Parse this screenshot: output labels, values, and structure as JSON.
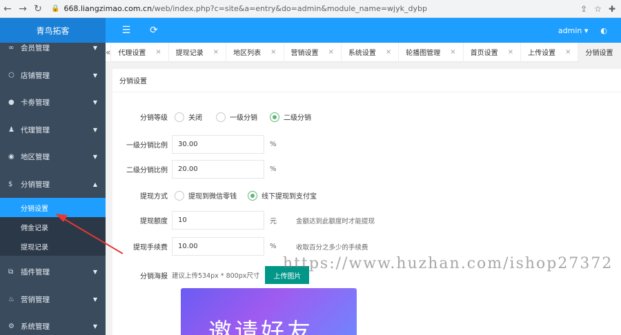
{
  "browser": {
    "url_host": "668.liangzimao.com.cn",
    "url_path": "/web/index.php?c=site&a=entry&do=admin&module_name=wjyk_dybp"
  },
  "header": {
    "brand": "青鸟拓客",
    "user": "admin"
  },
  "sidebar": {
    "items": [
      {
        "label": "会员管理",
        "icon": "link-icon"
      },
      {
        "label": "店铺管理",
        "icon": "cube-icon"
      },
      {
        "label": "卡劵管理",
        "icon": "circle-icon"
      },
      {
        "label": "代理管理",
        "icon": "user-icon"
      },
      {
        "label": "地区管理",
        "icon": "compass-icon"
      },
      {
        "label": "分销管理",
        "icon": "money-icon"
      }
    ],
    "sub_items": [
      {
        "label": "分销设置",
        "active": true
      },
      {
        "label": "佣金记录",
        "active": false
      },
      {
        "label": "提现记录",
        "active": false
      }
    ],
    "more_items": [
      {
        "label": "插件管理",
        "icon": "plugin-icon"
      },
      {
        "label": "营销管理",
        "icon": "fire-icon"
      },
      {
        "label": "系统管理",
        "icon": "gear-icon"
      }
    ]
  },
  "tabs": [
    {
      "label": "代理设置"
    },
    {
      "label": "提现记录"
    },
    {
      "label": "地区列表"
    },
    {
      "label": "营销设置"
    },
    {
      "label": "系统设置"
    },
    {
      "label": "轮播图管理"
    },
    {
      "label": "首页设置"
    },
    {
      "label": "上传设置"
    },
    {
      "label": "分销设置",
      "active": true
    }
  ],
  "panel": {
    "title": "分销设置"
  },
  "form": {
    "level_label": "分销等级",
    "level_options": [
      "关闭",
      "一级分销",
      "二级分销"
    ],
    "level_selected": "二级分销",
    "first_ratio_label": "一级分销比例",
    "first_ratio_value": "30.00",
    "second_ratio_label": "二级分销比例",
    "second_ratio_value": "20.00",
    "percent_unit": "%",
    "withdraw_method_label": "提现方式",
    "withdraw_options": [
      "提现到微信零钱",
      "线下提现到支付宝"
    ],
    "withdraw_selected": "线下提现到支付宝",
    "withdraw_amount_label": "提现额度",
    "withdraw_amount_value": "10",
    "yuan_unit": "元",
    "withdraw_amount_hint": "金额达到此额度时才能提现",
    "fee_label": "提现手续费",
    "fee_value": "10.00",
    "fee_hint": "收取百分之多少的手续费",
    "poster_label": "分销海报",
    "poster_hint": "建议上传534px * 800px尺寸",
    "upload_label": "上传图片",
    "poster_text": "邀请好友"
  },
  "watermark": "https://www.huzhan.com/ishop27372",
  "colors": {
    "primary": "#1e9fff",
    "sidebar": "#3a4b5e",
    "success": "#5fb878",
    "teal": "#009688"
  }
}
